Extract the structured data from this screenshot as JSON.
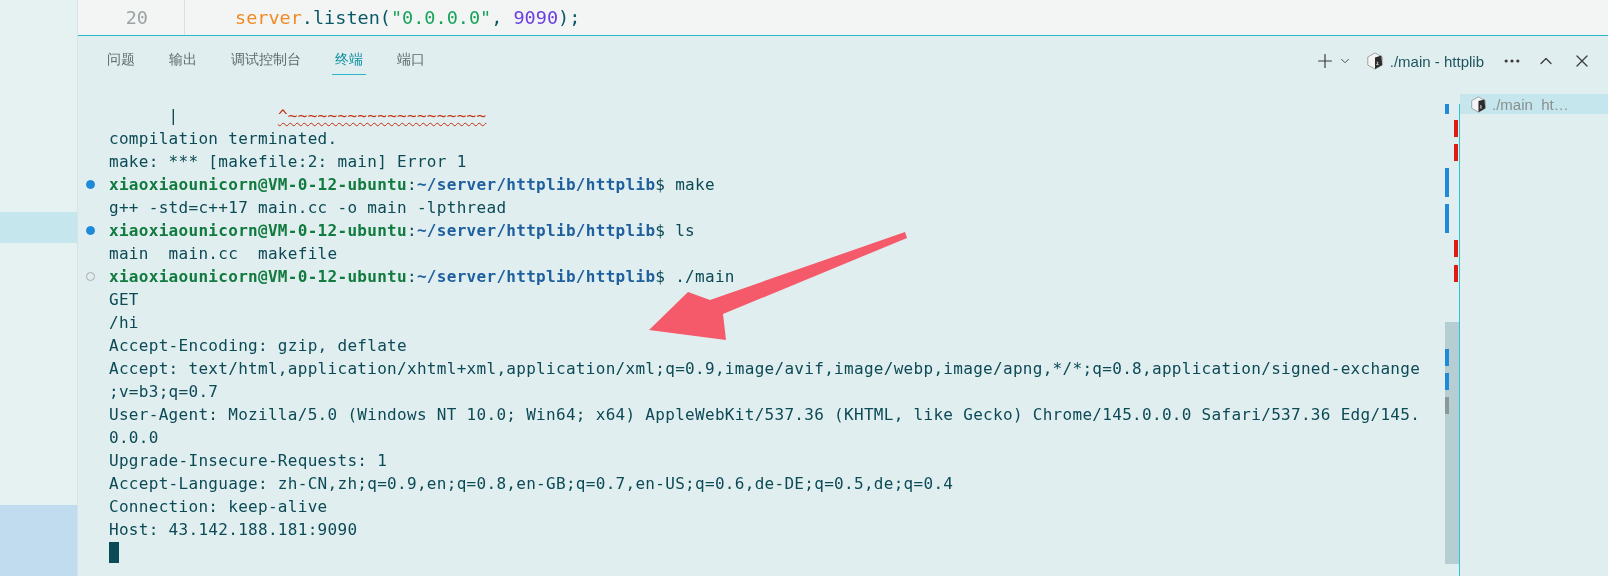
{
  "editor": {
    "line_number": "20",
    "tokens": [
      {
        "kind": "variable",
        "text": "server"
      },
      {
        "kind": "punct",
        "text": "."
      },
      {
        "kind": "function",
        "text": "listen"
      },
      {
        "kind": "punct",
        "text": "("
      },
      {
        "kind": "string",
        "text": "\"0.0.0.0\""
      },
      {
        "kind": "punct",
        "text": ", "
      },
      {
        "kind": "number",
        "text": "9090"
      },
      {
        "kind": "punct",
        "text": ");"
      }
    ]
  },
  "panel": {
    "tabs": [
      {
        "label": "问题",
        "selected": false
      },
      {
        "label": "输出",
        "selected": false
      },
      {
        "label": "调试控制台",
        "selected": false
      },
      {
        "label": "终端",
        "selected": true
      },
      {
        "label": "端口",
        "selected": false
      }
    ],
    "terminal_title": "./main - httplib"
  },
  "terminal": {
    "lines": [
      {
        "kind": "marker",
        "gutter": "|",
        "marker": "^~~~~~~~~~~~~~~~~~~~~"
      },
      {
        "kind": "output",
        "text": "compilation terminated."
      },
      {
        "kind": "output",
        "text": "make: *** [makefile:2: main] Error 1"
      },
      {
        "kind": "prompt",
        "completed": true,
        "user": "xiaoxiaounicorn@VM-0-12-ubuntu",
        "separator": ":",
        "path": "~/server/httplib/httplib",
        "sign": "$",
        "command": "make"
      },
      {
        "kind": "output",
        "text": "g++ -std=c++17 main.cc -o main -lpthread"
      },
      {
        "kind": "prompt",
        "completed": true,
        "user": "xiaoxiaounicorn@VM-0-12-ubuntu",
        "separator": ":",
        "path": "~/server/httplib/httplib",
        "sign": "$",
        "command": "ls"
      },
      {
        "kind": "output",
        "text": "main  main.cc  makefile"
      },
      {
        "kind": "prompt",
        "completed": false,
        "user": "xiaoxiaounicorn@VM-0-12-ubuntu",
        "separator": ":",
        "path": "~/server/httplib/httplib",
        "sign": "$",
        "command": "./main"
      },
      {
        "kind": "output",
        "text": "GET"
      },
      {
        "kind": "output",
        "text": "/hi"
      },
      {
        "kind": "output",
        "text": "Accept-Encoding: gzip, deflate"
      },
      {
        "kind": "output",
        "text": "Accept: text/html,application/xhtml+xml,application/xml;q=0.9,image/avif,image/webp,image/apng,*/*;q=0.8,application/signed-exchange"
      },
      {
        "kind": "output",
        "text": ";v=b3;q=0.7"
      },
      {
        "kind": "output",
        "text": "User-Agent: Mozilla/5.0 (Windows NT 10.0; Win64; x64) AppleWebKit/537.36 (KHTML, like Gecko) Chrome/145.0.0.0 Safari/537.36 Edg/145."
      },
      {
        "kind": "output",
        "text": "0.0.0"
      },
      {
        "kind": "output",
        "text": "Upgrade-Insecure-Requests: 1"
      },
      {
        "kind": "output",
        "text": "Accept-Language: zh-CN,zh;q=0.9,en;q=0.8,en-GB;q=0.7,en-US;q=0.6,de-DE;q=0.5,de;q=0.4"
      },
      {
        "kind": "output",
        "text": "Connection: keep-alive"
      },
      {
        "kind": "output",
        "text": "Host: 43.142.188.181:9090"
      },
      {
        "kind": "cursor"
      }
    ]
  },
  "terminal_list": [
    {
      "label": "./main  ht…",
      "selected": true
    }
  ]
}
